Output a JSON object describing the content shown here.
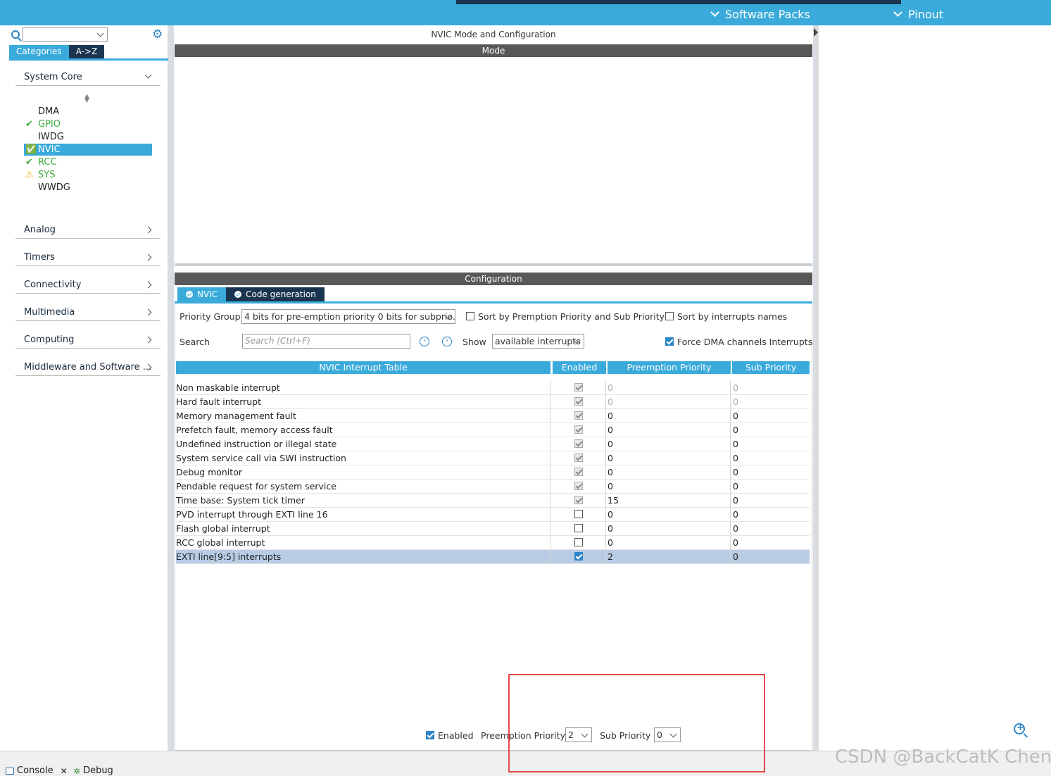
{
  "topbar": {
    "menus": [
      "Software Packs",
      "Pinout"
    ]
  },
  "left": {
    "tabs": [
      "Categories",
      "A->Z"
    ],
    "system_core": "System Core",
    "items": [
      {
        "label": "DMA",
        "state": "none"
      },
      {
        "label": "GPIO",
        "state": "ok"
      },
      {
        "label": "IWDG",
        "state": "none"
      },
      {
        "label": "NVIC",
        "state": "selected"
      },
      {
        "label": "RCC",
        "state": "ok"
      },
      {
        "label": "SYS",
        "state": "warn"
      },
      {
        "label": "WWDG",
        "state": "none"
      }
    ],
    "categories": [
      "Analog",
      "Timers",
      "Connectivity",
      "Multimedia",
      "Computing",
      "Middleware and Software ..."
    ]
  },
  "center": {
    "title": "NVIC Mode and Configuration",
    "mode_bar": "Mode",
    "config_bar": "Configuration",
    "tabs": [
      "NVIC",
      "Code generation"
    ],
    "priority_group_label": "Priority Group",
    "priority_group_value": "4 bits for pre-emption priority 0 bits for subprio...",
    "sort_prempt": "Sort by Premption Priority and Sub Priority",
    "sort_names": "Sort by interrupts names",
    "search_label": "Search",
    "search_placeholder": "Search (Ctrl+F)",
    "show_label": "Show",
    "show_value": "available interrupts",
    "force_dma": "Force DMA channels Interrupts",
    "headers": [
      "NVIC Interrupt Table",
      "Enabled",
      "Preemption Priority",
      "Sub Priority"
    ],
    "rows": [
      {
        "name": "Non maskable interrupt",
        "enabled": "grey",
        "pp": "0",
        "sp": "0",
        "dim": true
      },
      {
        "name": "Hard fault interrupt",
        "enabled": "grey",
        "pp": "0",
        "sp": "0",
        "dim": true
      },
      {
        "name": "Memory management fault",
        "enabled": "grey",
        "pp": "0",
        "sp": "0",
        "dim": false
      },
      {
        "name": "Prefetch fault, memory access fault",
        "enabled": "grey",
        "pp": "0",
        "sp": "0",
        "dim": false
      },
      {
        "name": "Undefined instruction or illegal state",
        "enabled": "grey",
        "pp": "0",
        "sp": "0",
        "dim": false
      },
      {
        "name": "System service call via SWI instruction",
        "enabled": "grey",
        "pp": "0",
        "sp": "0",
        "dim": false
      },
      {
        "name": "Debug monitor",
        "enabled": "grey",
        "pp": "0",
        "sp": "0",
        "dim": false
      },
      {
        "name": "Pendable request for system service",
        "enabled": "grey",
        "pp": "0",
        "sp": "0",
        "dim": false
      },
      {
        "name": "Time base: System tick timer",
        "enabled": "grey",
        "pp": "15",
        "sp": "0",
        "dim": false
      },
      {
        "name": "PVD interrupt through EXTI line 16",
        "enabled": "off",
        "pp": "0",
        "sp": "0",
        "dim": false
      },
      {
        "name": "Flash global interrupt",
        "enabled": "off",
        "pp": "0",
        "sp": "0",
        "dim": false
      },
      {
        "name": "RCC global interrupt",
        "enabled": "off",
        "pp": "0",
        "sp": "0",
        "dim": false
      },
      {
        "name": "EXTI line[9:5] interrupts",
        "enabled": "on",
        "pp": "2",
        "sp": "0",
        "dim": false,
        "highlight": true
      }
    ],
    "footer": {
      "enabled_label": "Enabled",
      "pp_label": "Preemption Priority",
      "pp_value": "2",
      "sp_label": "Sub Priority",
      "sp_value": "0"
    }
  },
  "bottom": {
    "console": "Console",
    "debug": "Debug"
  },
  "watermark": "CSDN @BackCatK Chen"
}
